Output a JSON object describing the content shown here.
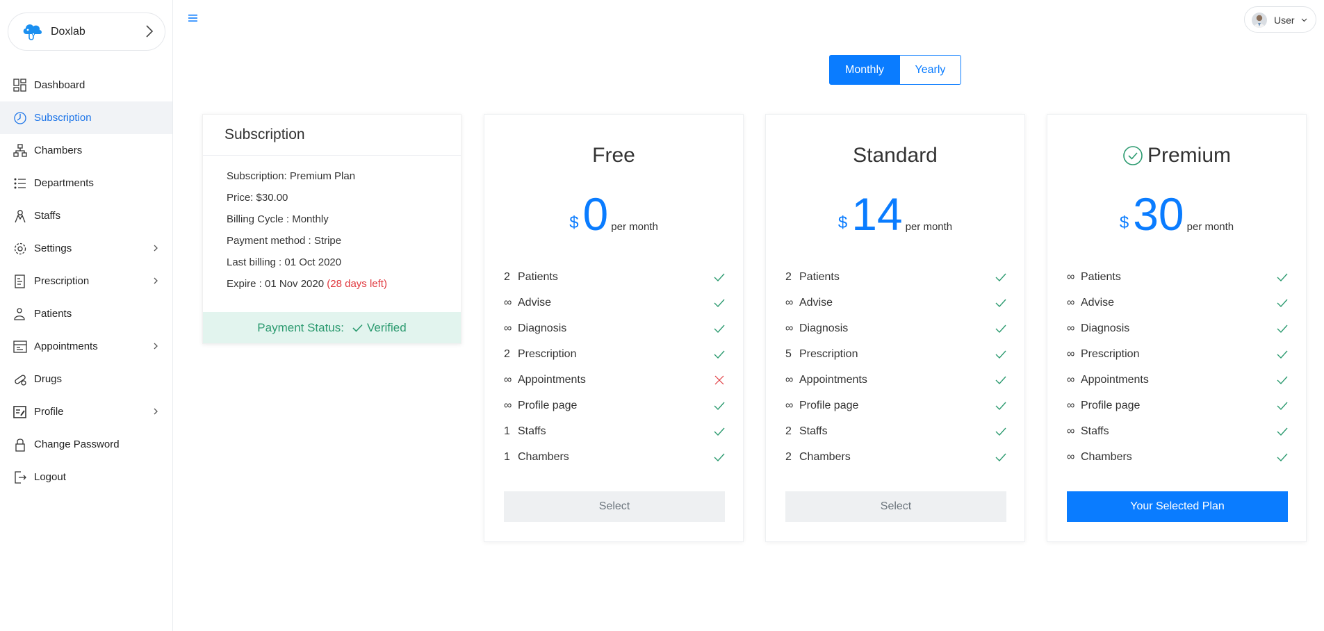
{
  "brand": {
    "name": "Doxlab"
  },
  "sidebar": {
    "items": [
      {
        "label": "Dashboard",
        "icon": "dashboard-icon",
        "chevron": false,
        "active": false
      },
      {
        "label": "Subscription",
        "icon": "subscription-icon",
        "chevron": false,
        "active": true
      },
      {
        "label": "Chambers",
        "icon": "chambers-icon",
        "chevron": false,
        "active": false
      },
      {
        "label": "Departments",
        "icon": "departments-icon",
        "chevron": false,
        "active": false
      },
      {
        "label": "Staffs",
        "icon": "staffs-icon",
        "chevron": false,
        "active": false
      },
      {
        "label": "Settings",
        "icon": "settings-icon",
        "chevron": true,
        "active": false
      },
      {
        "label": "Prescription",
        "icon": "prescription-icon",
        "chevron": true,
        "active": false
      },
      {
        "label": "Patients",
        "icon": "patients-icon",
        "chevron": false,
        "active": false
      },
      {
        "label": "Appointments",
        "icon": "appointments-icon",
        "chevron": true,
        "active": false
      },
      {
        "label": "Drugs",
        "icon": "drugs-icon",
        "chevron": false,
        "active": false
      },
      {
        "label": "Profile",
        "icon": "profile-icon",
        "chevron": true,
        "active": false
      },
      {
        "label": "Change Password",
        "icon": "lock-icon",
        "chevron": false,
        "active": false
      },
      {
        "label": "Logout",
        "icon": "logout-icon",
        "chevron": false,
        "active": false
      }
    ]
  },
  "header": {
    "user_label": "User"
  },
  "billing_toggle": {
    "monthly": "Monthly",
    "yearly": "Yearly",
    "selected": "Monthly"
  },
  "subscription_card": {
    "title": "Subscription",
    "lines": {
      "plan": "Subscription: Premium Plan",
      "price": "Price: $30.00",
      "cycle": "Billing Cycle : Monthly",
      "method": "Payment method : Stripe",
      "last_billing": "Last billing : 01 Oct 2020",
      "expire": "Expire : 01 Nov 2020",
      "days_left": "(28 days left)"
    },
    "status_label": "Payment Status:",
    "status_value": "Verified"
  },
  "plans": [
    {
      "name": "Free",
      "currency": "$",
      "amount": "0",
      "period": "per month",
      "selected": false,
      "features": [
        {
          "qty": "2",
          "label": "Patients",
          "ok": true
        },
        {
          "qty": "∞",
          "label": "Advise",
          "ok": true
        },
        {
          "qty": "∞",
          "label": "Diagnosis",
          "ok": true
        },
        {
          "qty": "2",
          "label": "Prescription",
          "ok": true
        },
        {
          "qty": "∞",
          "label": "Appointments",
          "ok": false
        },
        {
          "qty": "∞",
          "label": "Profile page",
          "ok": true
        },
        {
          "qty": "1",
          "label": "Staffs",
          "ok": true
        },
        {
          "qty": "1",
          "label": "Chambers",
          "ok": true
        }
      ],
      "button": "Select"
    },
    {
      "name": "Standard",
      "currency": "$",
      "amount": "14",
      "period": "per month",
      "selected": false,
      "features": [
        {
          "qty": "2",
          "label": "Patients",
          "ok": true
        },
        {
          "qty": "∞",
          "label": "Advise",
          "ok": true
        },
        {
          "qty": "∞",
          "label": "Diagnosis",
          "ok": true
        },
        {
          "qty": "5",
          "label": "Prescription",
          "ok": true
        },
        {
          "qty": "∞",
          "label": "Appointments",
          "ok": true
        },
        {
          "qty": "∞",
          "label": "Profile page",
          "ok": true
        },
        {
          "qty": "2",
          "label": "Staffs",
          "ok": true
        },
        {
          "qty": "2",
          "label": "Chambers",
          "ok": true
        }
      ],
      "button": "Select"
    },
    {
      "name": "Premium",
      "currency": "$",
      "amount": "30",
      "period": "per month",
      "selected": true,
      "features": [
        {
          "qty": "∞",
          "label": "Patients",
          "ok": true
        },
        {
          "qty": "∞",
          "label": "Advise",
          "ok": true
        },
        {
          "qty": "∞",
          "label": "Diagnosis",
          "ok": true
        },
        {
          "qty": "∞",
          "label": "Prescription",
          "ok": true
        },
        {
          "qty": "∞",
          "label": "Appointments",
          "ok": true
        },
        {
          "qty": "∞",
          "label": "Profile page",
          "ok": true
        },
        {
          "qty": "∞",
          "label": "Staffs",
          "ok": true
        },
        {
          "qty": "∞",
          "label": "Chambers",
          "ok": true
        }
      ],
      "button": "Your Selected Plan"
    }
  ],
  "colors": {
    "accent": "#0a7cff",
    "success": "#2b9a6f",
    "danger": "#e0383e",
    "muted": "#6c757d"
  }
}
